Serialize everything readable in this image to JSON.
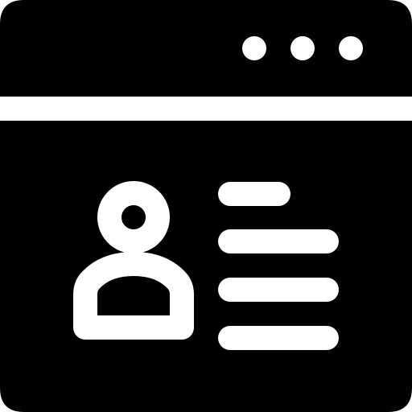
{
  "icon": {
    "name": "browser-profile-icon",
    "foreground": "#000000",
    "background": "#ffffff",
    "parts": {
      "window_dots": [
        "dot-icon",
        "dot-icon",
        "dot-icon"
      ],
      "avatar": "user-avatar-icon",
      "text_lines": [
        "text-line",
        "text-line",
        "text-line",
        "text-line"
      ]
    }
  }
}
